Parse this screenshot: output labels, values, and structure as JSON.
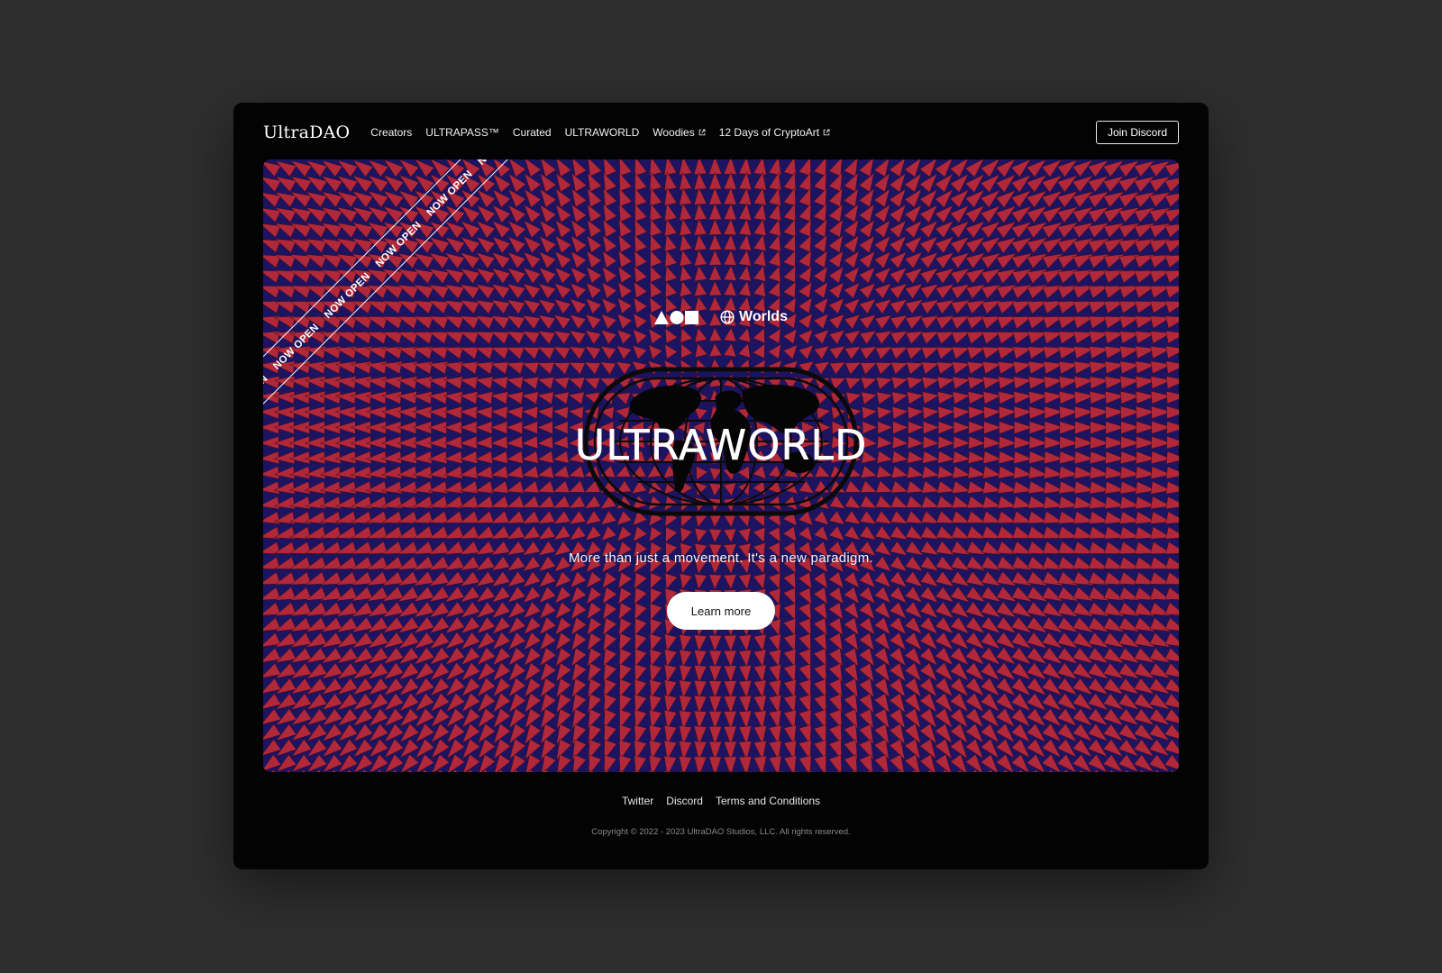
{
  "header": {
    "logo": "UltraDAO",
    "nav": [
      {
        "label": "Creators",
        "external": false
      },
      {
        "label": "ULTRAPASS™",
        "external": false
      },
      {
        "label": "Curated",
        "external": false
      },
      {
        "label": "ULTRAWORLD",
        "external": false
      },
      {
        "label": "Woodies",
        "external": true
      },
      {
        "label": "12 Days of CryptoArt",
        "external": true
      }
    ],
    "join_label": "Join Discord"
  },
  "hero": {
    "banner_text": "NOW OPEN",
    "shape_icons": [
      "triangle-icon",
      "circle-icon",
      "square-icon"
    ],
    "section_icon": "globe-icon",
    "section_label": "Worlds",
    "title": "ULTRAWORLD",
    "tagline": "More than just a movement. It's a new paradigm.",
    "cta_label": "Learn more",
    "colors": {
      "pattern_red": "#b0283a",
      "pattern_navy": "#1d1461",
      "emblem": "#0a0a0a"
    }
  },
  "footer": {
    "links": [
      "Twitter",
      "Discord",
      "Terms and Conditions"
    ],
    "copyright": "Copyright © 2022 - 2023 UltraDAO Studios, LLC. All rights reserved."
  },
  "colors": {
    "page_bg": "#2e2e2e",
    "window_bg": "#030303",
    "text": "#ffffff"
  }
}
